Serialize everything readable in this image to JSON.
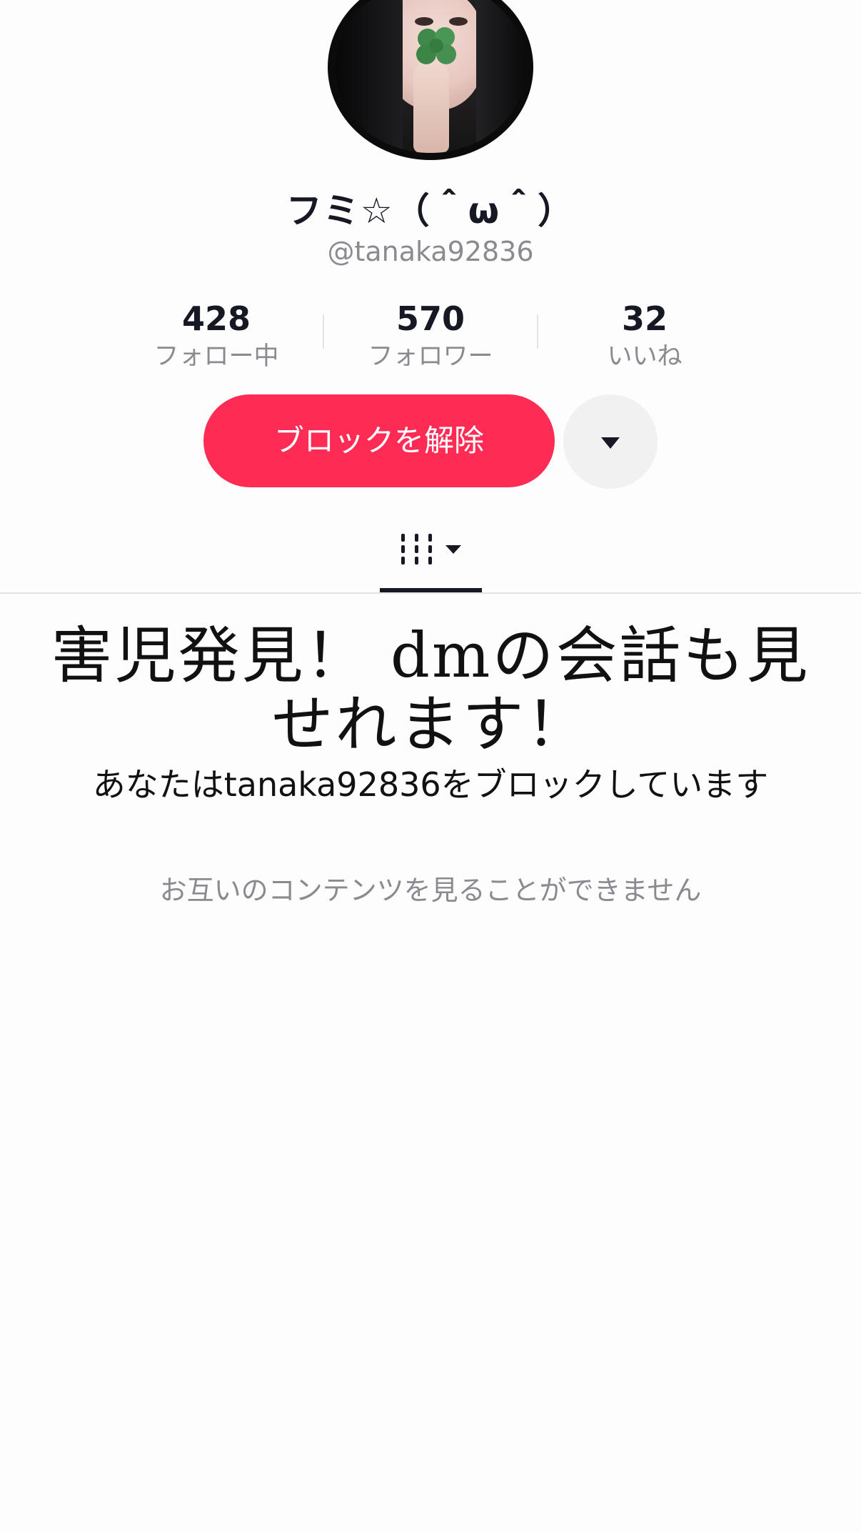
{
  "profile": {
    "display_name": "フミ☆（＾ω＾）",
    "username": "@tanaka92836"
  },
  "stats": [
    {
      "value": "428",
      "label": "フォロー中"
    },
    {
      "value": "570",
      "label": "フォロワー"
    },
    {
      "value": "32",
      "label": "いいね"
    }
  ],
  "actions": {
    "unblock_label": "ブロックを解除"
  },
  "overlay": {
    "line1": "害児発見！ dmの会話も見",
    "line2": "せれます！"
  },
  "blocked": {
    "title": "あなたはtanaka92836をブロックしています",
    "subtitle": "お互いのコンテンツを見ることができません"
  },
  "icons": {
    "more": "chevron-down-icon",
    "tab": "videos-grid-icon"
  },
  "colors": {
    "accent": "#fe2c55",
    "secondary_text": "#8a8b91"
  }
}
